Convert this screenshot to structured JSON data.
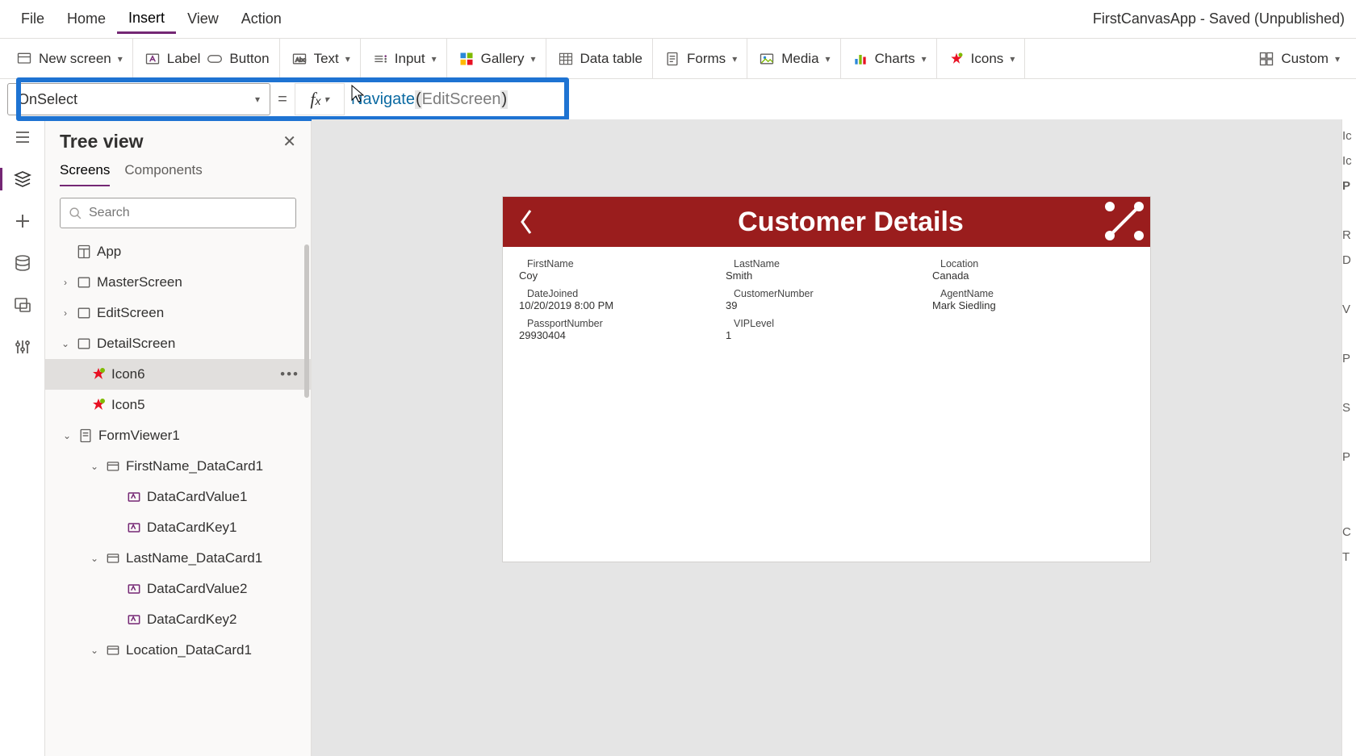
{
  "menu": {
    "file": "File",
    "home": "Home",
    "insert": "Insert",
    "view": "View",
    "action": "Action"
  },
  "app_title": "FirstCanvasApp - Saved (Unpublished)",
  "ribbon": {
    "new_screen": "New screen",
    "label": "Label",
    "button": "Button",
    "text": "Text",
    "input": "Input",
    "gallery": "Gallery",
    "data_table": "Data table",
    "forms": "Forms",
    "media": "Media",
    "charts": "Charts",
    "icons": "Icons",
    "custom": "Custom"
  },
  "formula": {
    "property": "OnSelect",
    "fn": "Navigate",
    "arg": "EditScreen"
  },
  "tree": {
    "title": "Tree view",
    "tab_screens": "Screens",
    "tab_components": "Components",
    "search_ph": "Search",
    "app": "App",
    "items": {
      "master": "MasterScreen",
      "edit": "EditScreen",
      "detail": "DetailScreen",
      "icon6": "Icon6",
      "icon5": "Icon5",
      "formviewer": "FormViewer1",
      "fn_card": "FirstName_DataCard1",
      "dcv1": "DataCardValue1",
      "dck1": "DataCardKey1",
      "ln_card": "LastName_DataCard1",
      "dcv2": "DataCardValue2",
      "dck2": "DataCardKey2",
      "loc_card": "Location_DataCard1"
    }
  },
  "preview": {
    "title": "Customer Details",
    "fields": {
      "firstname_l": "FirstName",
      "firstname_v": "Coy",
      "lastname_l": "LastName",
      "lastname_v": "Smith",
      "location_l": "Location",
      "location_v": "Canada",
      "datejoined_l": "DateJoined",
      "datejoined_v": "10/20/2019 8:00 PM",
      "custnum_l": "CustomerNumber",
      "custnum_v": "39",
      "agent_l": "AgentName",
      "agent_v": "Mark Siedling",
      "passport_l": "PassportNumber",
      "passport_v": "29930404",
      "vip_l": "VIPLevel",
      "vip_v": "1"
    }
  },
  "rightrail": [
    "Ic",
    "Ic",
    "P",
    "R",
    "D",
    "V",
    "P",
    "S",
    "P",
    "C",
    "T"
  ]
}
